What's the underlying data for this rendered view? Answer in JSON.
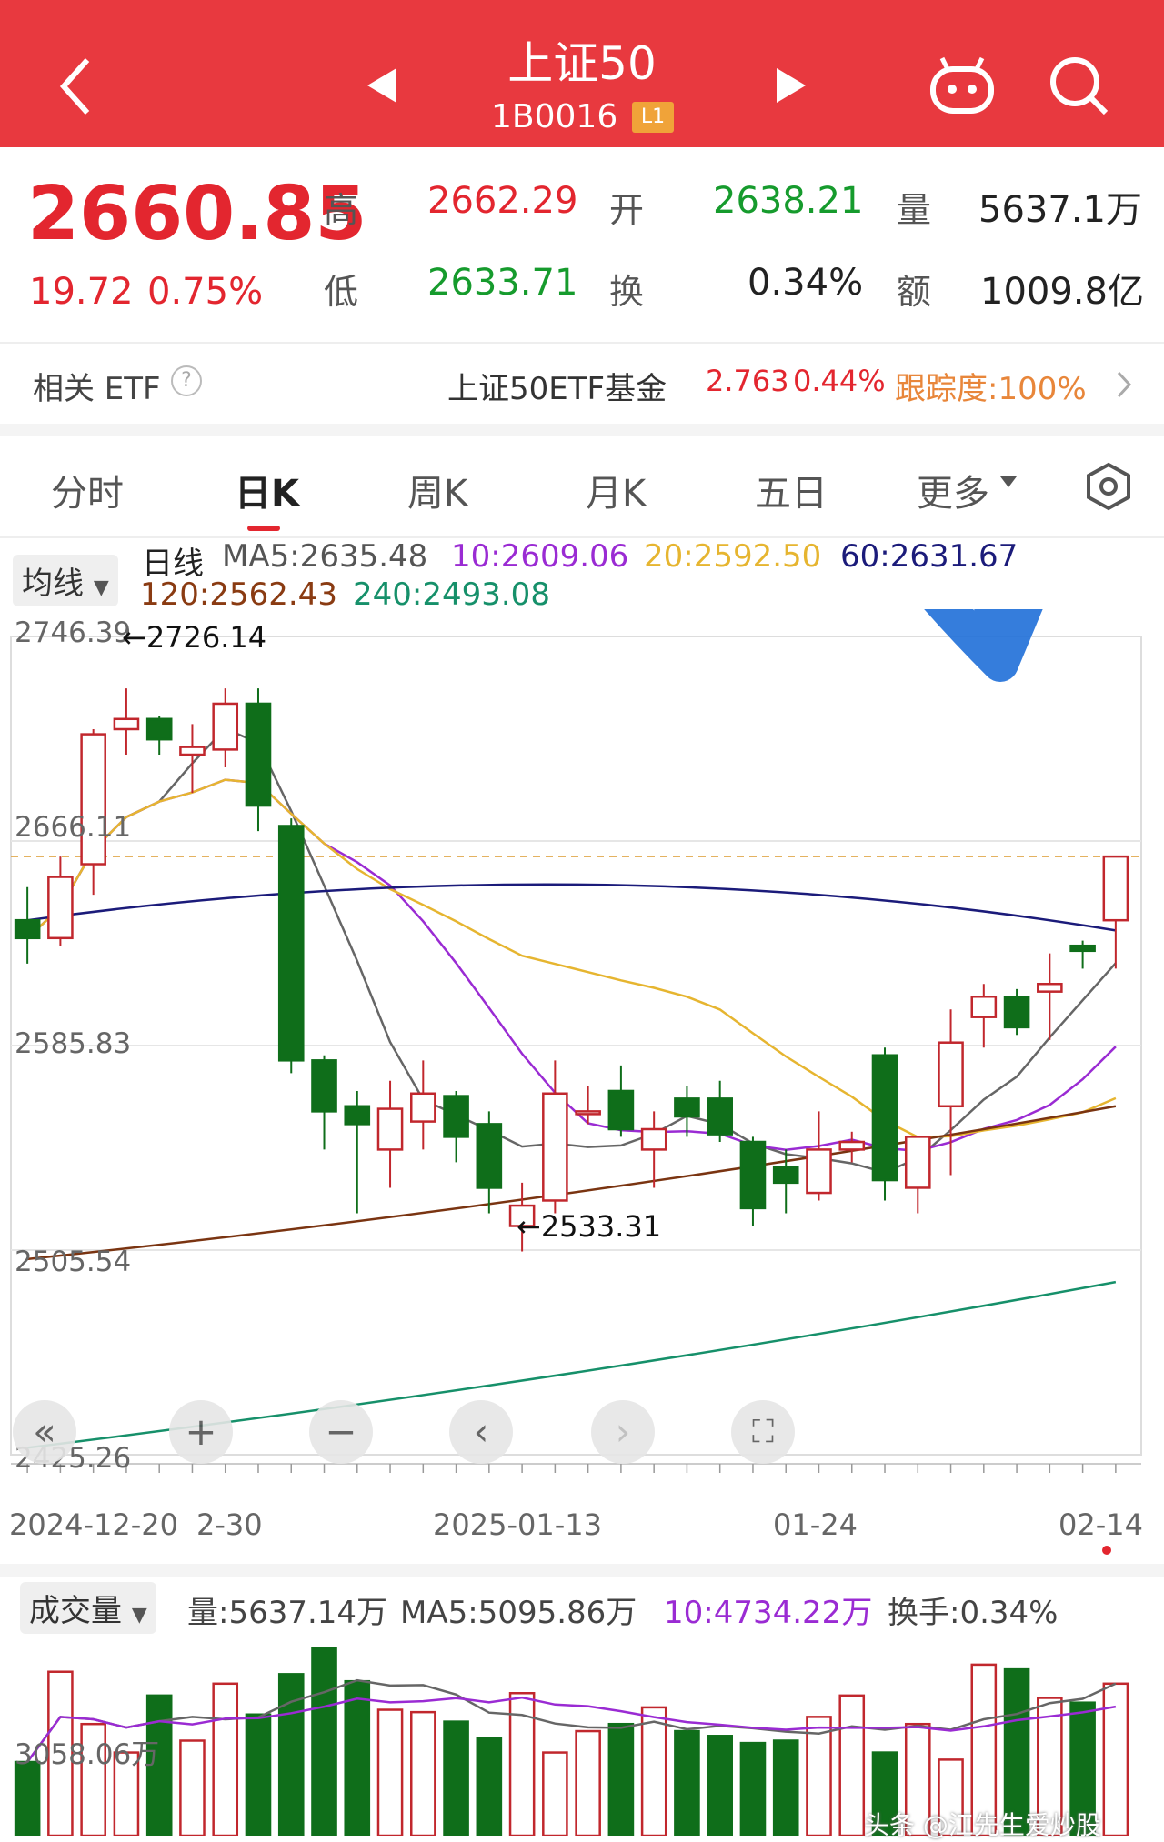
{
  "header": {
    "title": "上证50",
    "code": "1B0016",
    "level_badge": "L1",
    "bg_color": "#e8393f"
  },
  "quote": {
    "price": "2660.85",
    "change": "19.72",
    "change_pct": "0.75%",
    "high_label": "高",
    "high": "2662.29",
    "low_label": "低",
    "low": "2633.71",
    "open_label": "开",
    "open": "2638.21",
    "turnover_label": "换",
    "turnover": "0.34%",
    "volume_label": "量",
    "volume": "5637.1万",
    "amount_label": "额",
    "amount": "1009.8亿"
  },
  "etf": {
    "label": "相关 ETF",
    "help_icon": "?",
    "name": "上证50ETF基金",
    "price": "2.763",
    "pct": "0.44%",
    "tracking": "跟踪度:100%"
  },
  "tabs": [
    "分时",
    "日K",
    "周K",
    "月K",
    "五日",
    "更多"
  ],
  "active_tab": "日K",
  "ma_bar": {
    "selector": "均线",
    "title": "日线",
    "ma5": "MA5:2635.48",
    "ma10": "10:2609.06",
    "ma20": "20:2592.50",
    "ma60": "60:2631.67",
    "ma120": "120:2562.43",
    "ma240": "240:2493.08"
  },
  "price_axis": {
    "max": "2746.39",
    "mid_upper": "2666.11",
    "mid": "2585.83",
    "mid_lower": "2505.54",
    "min": "2425.26"
  },
  "annotations": {
    "high_mark": "←2726.14",
    "low_mark": "←2533.31"
  },
  "dates": [
    "2024-12-20",
    "2-30",
    "2025-01-13",
    "01-24",
    "02-14"
  ],
  "volume": {
    "selector": "成交量",
    "vol": "量:5637.14万",
    "ma5": "MA5:5095.86万",
    "ma10": "10:4734.22万",
    "turnover": "换手:0.34%",
    "axis_label": "3058.06万"
  },
  "watermark": "头条 @江先生爱炒股",
  "chart_data": {
    "type": "candlestick",
    "ylim": [
      2425.26,
      2746.39
    ],
    "candles": [
      {
        "o": 2635,
        "h": 2648,
        "l": 2618,
        "c": 2628
      },
      {
        "o": 2628,
        "h": 2660,
        "l": 2625,
        "c": 2652
      },
      {
        "o": 2657,
        "h": 2710,
        "l": 2645,
        "c": 2708
      },
      {
        "o": 2710,
        "h": 2726,
        "l": 2700,
        "c": 2714
      },
      {
        "o": 2714,
        "h": 2715,
        "l": 2700,
        "c": 2706
      },
      {
        "o": 2700,
        "h": 2712,
        "l": 2685,
        "c": 2703
      },
      {
        "o": 2702,
        "h": 2726,
        "l": 2695,
        "c": 2720
      },
      {
        "o": 2720,
        "h": 2726,
        "l": 2670,
        "c": 2680
      },
      {
        "o": 2672,
        "h": 2675,
        "l": 2575,
        "c": 2580
      },
      {
        "o": 2580,
        "h": 2582,
        "l": 2545,
        "c": 2560
      },
      {
        "o": 2562,
        "h": 2568,
        "l": 2520,
        "c": 2555
      },
      {
        "o": 2545,
        "h": 2572,
        "l": 2530,
        "c": 2561
      },
      {
        "o": 2556,
        "h": 2580,
        "l": 2545,
        "c": 2567
      },
      {
        "o": 2566,
        "h": 2568,
        "l": 2540,
        "c": 2550
      },
      {
        "o": 2555,
        "h": 2560,
        "l": 2520,
        "c": 2530
      },
      {
        "o": 2515,
        "h": 2532,
        "l": 2505,
        "c": 2523
      },
      {
        "o": 2525,
        "h": 2580,
        "l": 2520,
        "c": 2567
      },
      {
        "o": 2560,
        "h": 2570,
        "l": 2555,
        "c": 2560
      },
      {
        "o": 2568,
        "h": 2578,
        "l": 2550,
        "c": 2553
      },
      {
        "o": 2545,
        "h": 2560,
        "l": 2530,
        "c": 2553
      },
      {
        "o": 2565,
        "h": 2570,
        "l": 2550,
        "c": 2558
      },
      {
        "o": 2565,
        "h": 2572,
        "l": 2548,
        "c": 2551
      },
      {
        "o": 2548,
        "h": 2550,
        "l": 2515,
        "c": 2522
      },
      {
        "o": 2538,
        "h": 2545,
        "l": 2520,
        "c": 2532
      },
      {
        "o": 2528,
        "h": 2560,
        "l": 2525,
        "c": 2545
      },
      {
        "o": 2545,
        "h": 2552,
        "l": 2540,
        "c": 2548
      },
      {
        "o": 2582,
        "h": 2585,
        "l": 2525,
        "c": 2533
      },
      {
        "o": 2530,
        "h": 2540,
        "l": 2520,
        "c": 2550
      },
      {
        "o": 2562,
        "h": 2600,
        "l": 2535,
        "c": 2587
      },
      {
        "o": 2597,
        "h": 2610,
        "l": 2585,
        "c": 2605
      },
      {
        "o": 2605,
        "h": 2608,
        "l": 2590,
        "c": 2593
      },
      {
        "o": 2607,
        "h": 2622,
        "l": 2588,
        "c": 2610
      },
      {
        "o": 2625,
        "h": 2627,
        "l": 2616,
        "c": 2623
      },
      {
        "o": 2635,
        "h": 2640,
        "l": 2616,
        "c": 2660
      }
    ],
    "volumes": [
      3100,
      6900,
      4700,
      3500,
      5900,
      4000,
      6400,
      5100,
      6800,
      7900,
      6500,
      5300,
      5200,
      4800,
      4100,
      6000,
      3500,
      4400,
      4700,
      5400,
      4400,
      4200,
      3900,
      4000,
      5000,
      5900,
      3500,
      4700,
      3200,
      7200,
      7000,
      5800,
      5600,
      6400
    ]
  }
}
